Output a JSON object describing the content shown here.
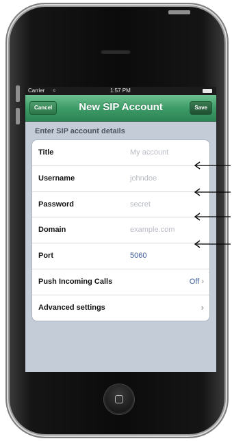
{
  "status_bar": {
    "carrier": "Carrier",
    "time": "1:57 PM"
  },
  "navbar": {
    "cancel_label": "Cancel",
    "title": "New SIP Account",
    "save_label": "Save"
  },
  "section_header": "Enter SIP account details",
  "rows": [
    {
      "label": "Title",
      "placeholder": "My account"
    },
    {
      "label": "Username",
      "placeholder": "johndoe"
    },
    {
      "label": "Password",
      "placeholder": "secret"
    },
    {
      "label": "Domain",
      "placeholder": "example.com"
    },
    {
      "label": "Port",
      "value": "5060"
    },
    {
      "label": "Push Incoming Calls",
      "value": "Off"
    },
    {
      "label": "Advanced settings"
    }
  ],
  "colors": {
    "navbar": "#3d9c68",
    "screen_background": "#c4ccd7",
    "value_text": "#3b5998"
  }
}
